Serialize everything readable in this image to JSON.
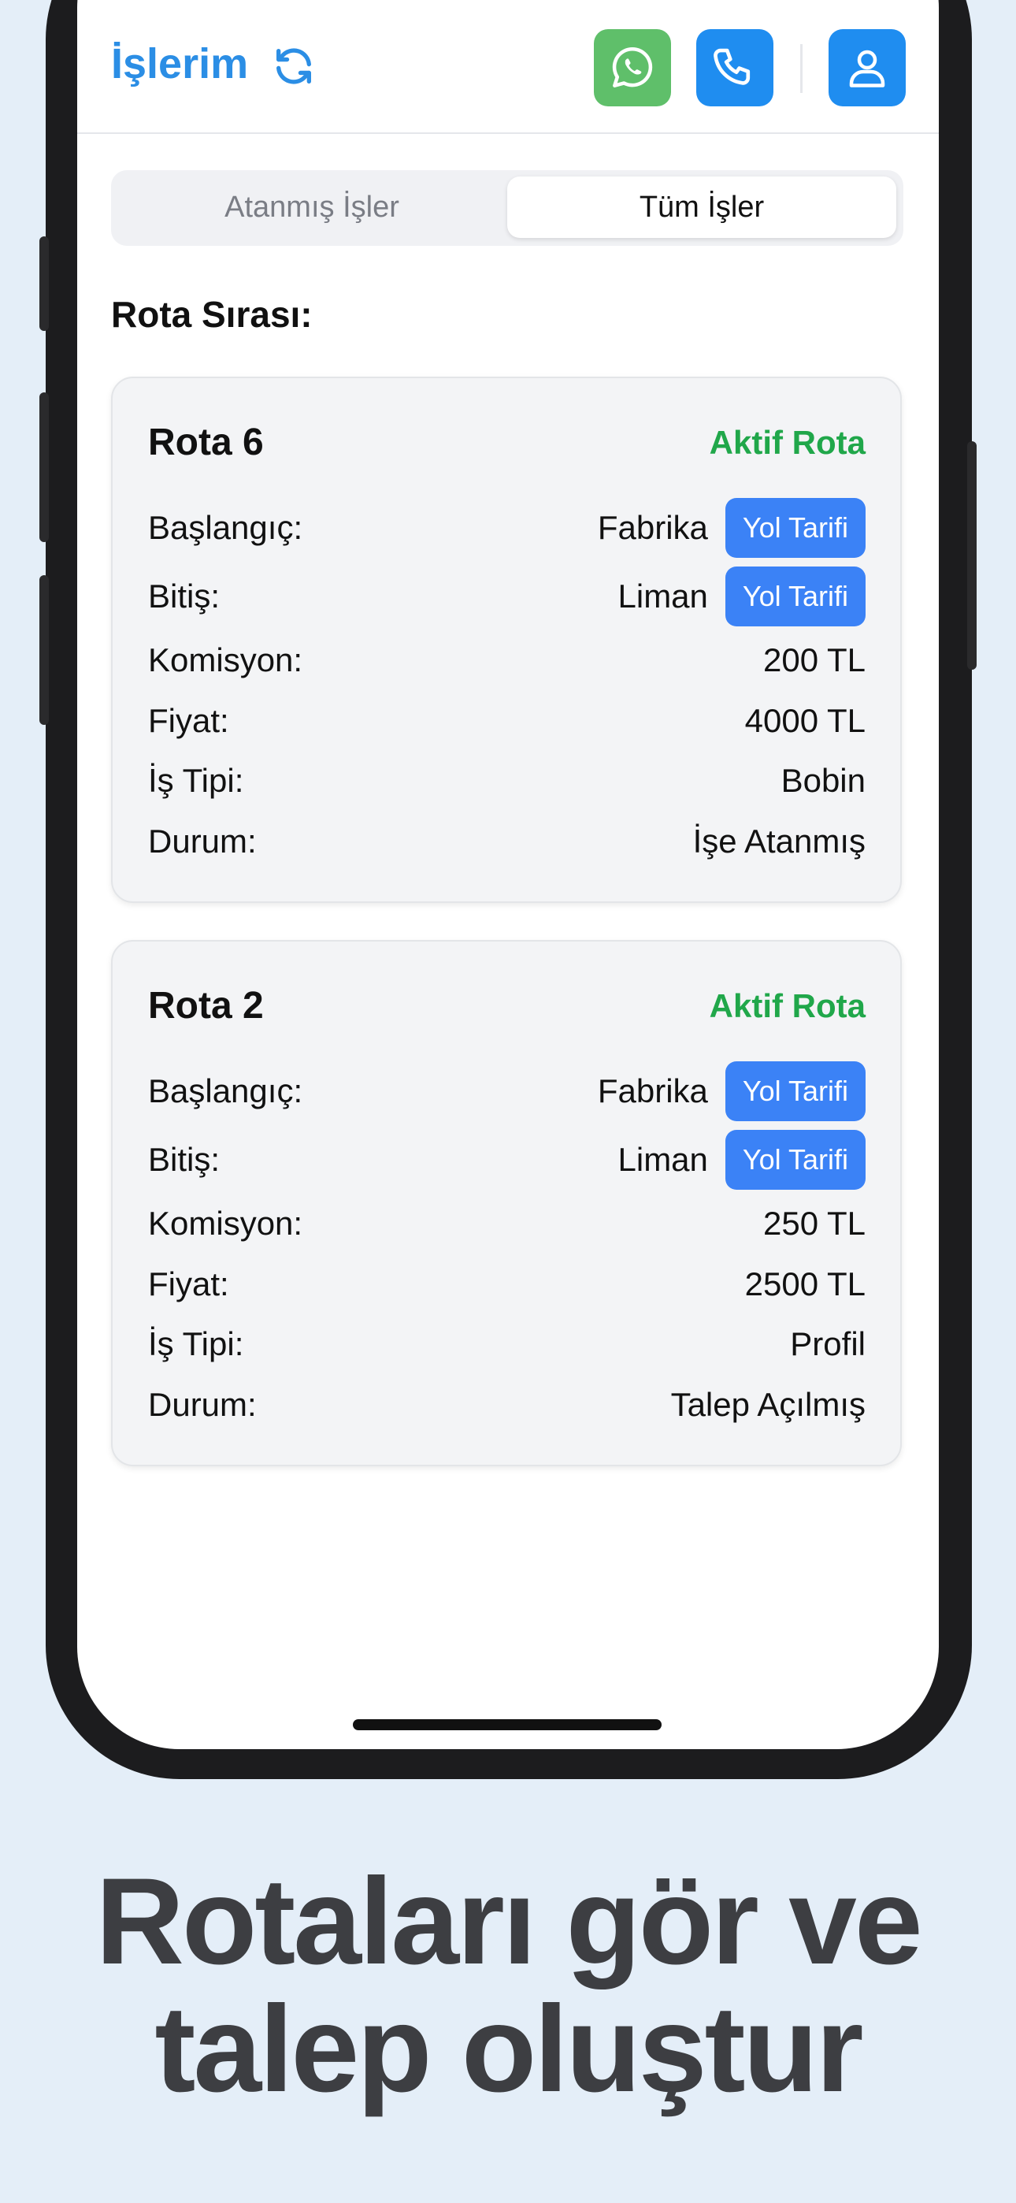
{
  "header": {
    "title": "İşlerim",
    "icons": [
      "refresh-icon",
      "whatsapp-icon",
      "phone-icon",
      "user-icon"
    ],
    "colors": {
      "accent": "#2b8ee5",
      "whatsapp": "#5fbf6a",
      "button_blue": "#1f8df0"
    }
  },
  "segment": {
    "tabs": [
      "Atanmış İşler",
      "Tüm İşler"
    ],
    "selected": "Tüm İşler"
  },
  "section_title": "Rota Sırası:",
  "routes": [
    {
      "name": "Rota 6",
      "status": "Aktif Rota",
      "labels": [
        "Başlangıç:",
        "Bitiş:",
        "Komisyon:",
        "Fiyat:",
        "İş Tipi:",
        "Durum:"
      ],
      "start": "Fabrika",
      "end": "Liman",
      "commission": "200 TL",
      "price": "4000 TL",
      "job_type": "Bobin",
      "state": "İşe Atanmış",
      "directions_label": "Yol Tarifi"
    },
    {
      "name": "Rota 2",
      "status": "Aktif Rota",
      "labels": [
        "Başlangıç:",
        "Bitiş:",
        "Komisyon:",
        "Fiyat:",
        "İş Tipi:",
        "Durum:"
      ],
      "start": "Fabrika",
      "end": "Liman",
      "commission": "250 TL",
      "price": "2500 TL",
      "job_type": "Profil",
      "state": "Talep Açılmış",
      "directions_label": "Yol Tarifi"
    }
  ],
  "caption": {
    "line1": "Rotaları gör ve",
    "line2": "talep oluştur"
  },
  "status_color": "#20a74a"
}
